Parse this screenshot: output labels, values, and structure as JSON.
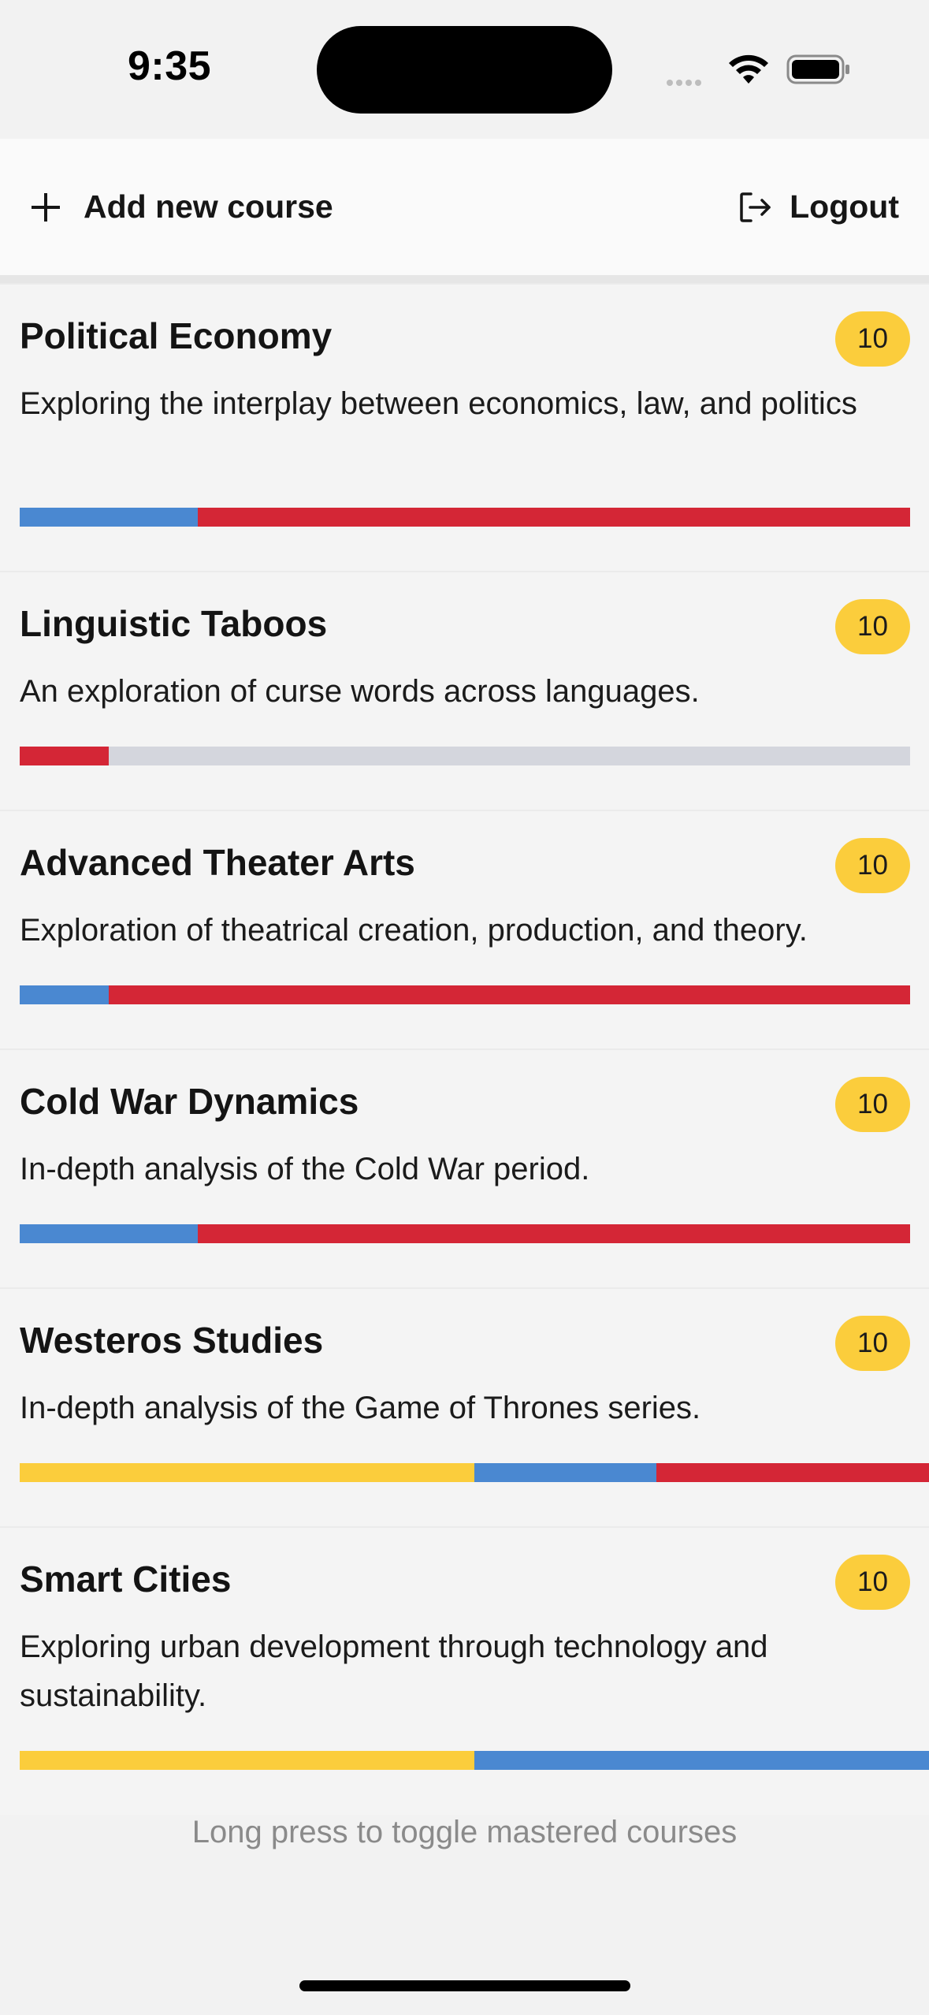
{
  "status_bar": {
    "time": "9:35",
    "icons": [
      "cellular-signal-icon",
      "wifi-icon",
      "battery-icon"
    ]
  },
  "header": {
    "add_label": "Add new course",
    "add_icon": "plus-icon",
    "logout_label": "Logout",
    "logout_icon": "logout-icon"
  },
  "colors": {
    "yellow": "#fbcd3c",
    "blue": "#4a88d1",
    "red": "#d42636",
    "gray": "#d4d6dd",
    "badge": "#fbcd3c"
  },
  "courses": [
    {
      "title": "Political Economy",
      "count": "10",
      "description": "Exploring the interplay between economics, law, and politics",
      "progress": [
        {
          "color": "blue",
          "fraction": 0.2
        },
        {
          "color": "red",
          "fraction": 0.8
        }
      ]
    },
    {
      "title": "Linguistic Taboos",
      "count": "10",
      "description": "An exploration of curse words across languages.",
      "progress": [
        {
          "color": "red",
          "fraction": 0.1
        },
        {
          "color": "gray",
          "fraction": 0.9
        }
      ]
    },
    {
      "title": "Advanced Theater Arts",
      "count": "10",
      "description": "Exploration of theatrical creation, production, and theory.",
      "progress": [
        {
          "color": "blue",
          "fraction": 0.1
        },
        {
          "color": "red",
          "fraction": 0.9
        }
      ]
    },
    {
      "title": "Cold War Dynamics",
      "count": "10",
      "description": "In-depth analysis of the Cold War period.",
      "progress": [
        {
          "color": "blue",
          "fraction": 0.2
        },
        {
          "color": "red",
          "fraction": 0.8
        }
      ]
    },
    {
      "title": "Westeros Studies",
      "count": "10",
      "description": "In-depth analysis of the Game of Thrones series.",
      "progress": [
        {
          "color": "yellow",
          "fraction": 0.5
        },
        {
          "color": "blue",
          "fraction": 0.2
        },
        {
          "color": "red",
          "fraction": 0.3
        }
      ]
    },
    {
      "title": "Smart Cities",
      "count": "10",
      "description": "Exploring urban development through technology and sustainability.",
      "progress": [
        {
          "color": "yellow",
          "fraction": 0.5
        },
        {
          "color": "blue",
          "fraction": 0.5
        }
      ]
    }
  ],
  "footer": {
    "hint": "Long press to toggle mastered courses"
  }
}
